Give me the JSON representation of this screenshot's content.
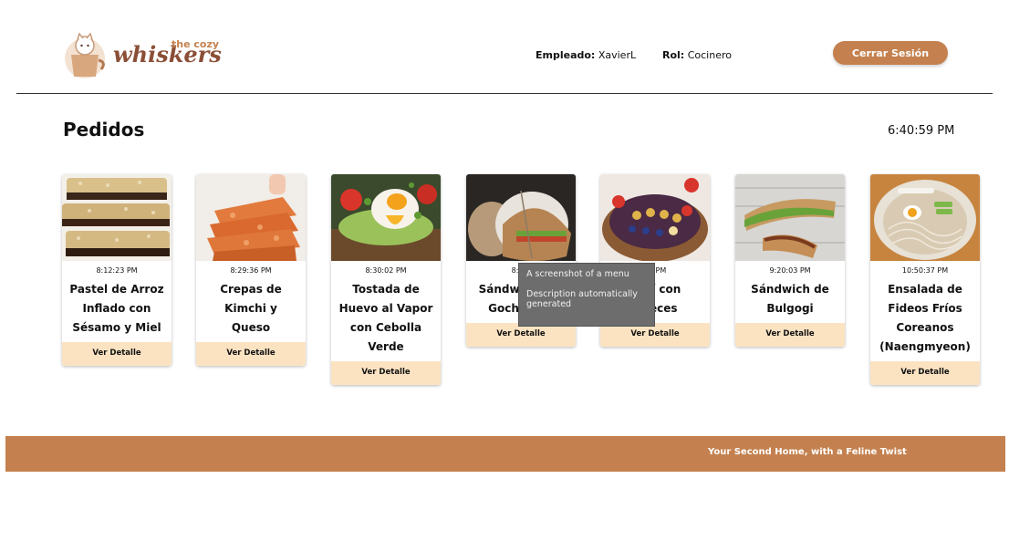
{
  "header": {
    "logo_text_small": "the cozy",
    "logo_text_main": "whiskers",
    "employee_label": "Empleado:",
    "employee_value": "XavierL",
    "role_label": "Rol:",
    "role_value": "Cocinero",
    "logout_label": "Cerrar Sesión"
  },
  "main": {
    "title": "Pedidos",
    "clock": "6:40:59 PM",
    "detail_label": "Ver Detalle",
    "orders": [
      {
        "time": "8:12:23 PM",
        "name": "Pastel de Arroz Inflado con Sésamo y Miel",
        "image": "rice-crispy-bars"
      },
      {
        "time": "8:29:36 PM",
        "name": "Crepas de Kimchi y Queso",
        "image": "kimchi-crepes"
      },
      {
        "time": "8:30:02 PM",
        "name": "Tostada de Huevo al Vapor con Cebolla Verde",
        "image": "egg-toast"
      },
      {
        "time": "8:30:",
        "name": "Sándwich con Gochujang",
        "image": "sandwich-wrapped"
      },
      {
        "time": "20 PM",
        "name": "Açaí con Nueces",
        "image": "acai-bowl"
      },
      {
        "time": "9:20:03 PM",
        "name": "Sándwich de Bulgogi",
        "image": "bulgogi-sandwich"
      },
      {
        "time": "10:50:37 PM",
        "name": "Ensalada de Fideos Fríos Coreanos (Naengmyeon)",
        "image": "cold-noodles"
      }
    ]
  },
  "tooltip": {
    "line1": "A screenshot of a menu",
    "line2": "Description automatically generated"
  },
  "footer": {
    "tagline": "Your Second Home, with a Feline Twist"
  },
  "colors": {
    "accent": "#c4814f",
    "detail_bg": "#fbe3c2",
    "tooltip_bg": "#6d6d6d"
  }
}
